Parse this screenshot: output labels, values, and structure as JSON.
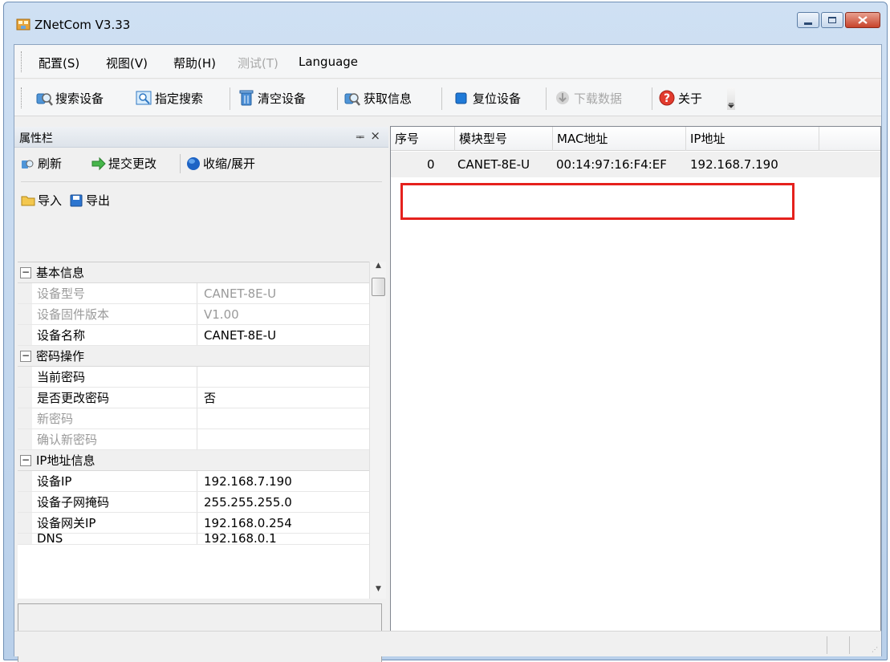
{
  "window": {
    "title": "ZNetCom V3.33"
  },
  "menu": [
    "配置(S)",
    "视图(V)",
    "帮助(H)",
    "测试(T)",
    "Language"
  ],
  "toolbar": {
    "search_device": "搜索设备",
    "specified_search": "指定搜索",
    "clear_devices": "清空设备",
    "get_info": "获取信息",
    "reset_device": "复位设备",
    "download_data": "下载数据",
    "about": "关于"
  },
  "property_panel": {
    "title": "属性栏",
    "pin_glyph": "ᆍ",
    "close_glyph": "×",
    "refresh": "刷新",
    "submit": "提交更改",
    "collapse_expand": "收缩/展开",
    "import": "导入",
    "export": "导出",
    "categories": {
      "basic": "基本信息",
      "password": "密码操作",
      "ip": "IP地址信息"
    },
    "rows": {
      "device_model": {
        "k": "设备型号",
        "v": "CANET-8E-U"
      },
      "firmware": {
        "k": "设备固件版本",
        "v": "V1.00"
      },
      "device_name": {
        "k": "设备名称",
        "v": "CANET-8E-U"
      },
      "current_pwd": {
        "k": "当前密码",
        "v": ""
      },
      "change_pwd": {
        "k": "是否更改密码",
        "v": "否"
      },
      "new_pwd": {
        "k": "新密码",
        "v": ""
      },
      "confirm_pwd": {
        "k": "确认新密码",
        "v": ""
      },
      "device_ip": {
        "k": "设备IP",
        "v": "192.168.7.190"
      },
      "subnet": {
        "k": "设备子网掩码",
        "v": "255.255.255.0"
      },
      "gateway": {
        "k": "设备网关IP",
        "v": "192.168.0.254"
      },
      "dns": {
        "k": "DNS",
        "v": "192.168.0.1"
      }
    }
  },
  "device_list": {
    "columns": [
      "序号",
      "模块型号",
      "MAC地址",
      "IP地址"
    ],
    "rows": [
      {
        "index": "0",
        "model": "CANET-8E-U",
        "mac": "00:14:97:16:F4:EF",
        "ip": "192.168.7.190"
      }
    ]
  },
  "colors": {
    "highlight": "#e5211d",
    "title_bar": "#b9d0ea"
  }
}
